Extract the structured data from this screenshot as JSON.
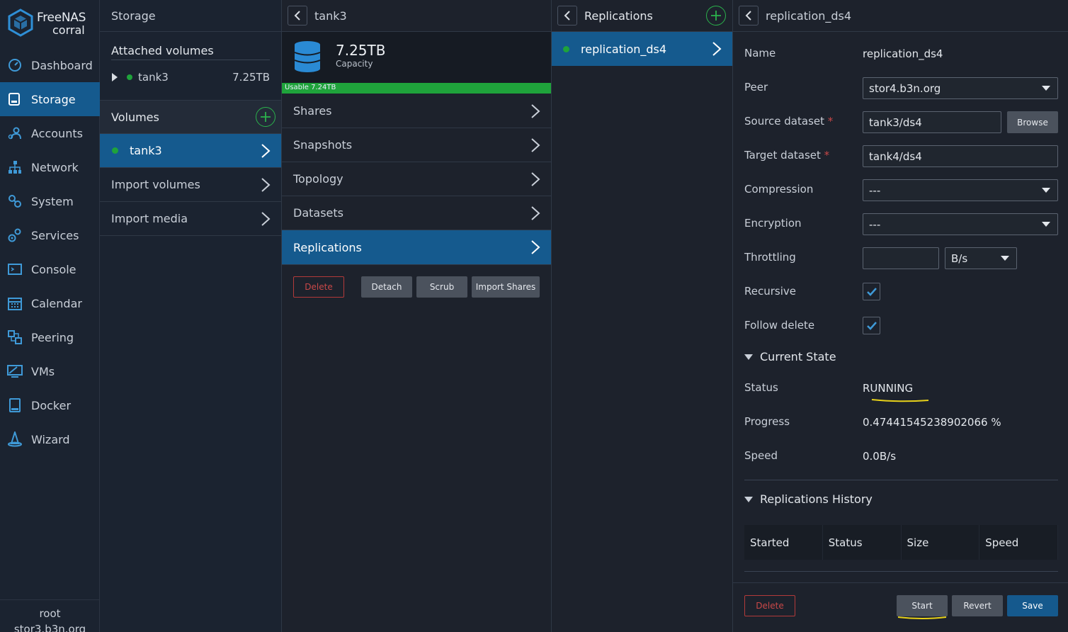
{
  "app": {
    "logo_line1": "FreeNAS",
    "logo_line2": "corral"
  },
  "sidebar": {
    "items": [
      {
        "label": "Dashboard",
        "icon": "dashboard-icon"
      },
      {
        "label": "Storage",
        "icon": "storage-icon",
        "active": true
      },
      {
        "label": "Accounts",
        "icon": "accounts-icon"
      },
      {
        "label": "Network",
        "icon": "network-icon"
      },
      {
        "label": "System",
        "icon": "system-icon"
      },
      {
        "label": "Services",
        "icon": "services-icon"
      },
      {
        "label": "Console",
        "icon": "console-icon"
      },
      {
        "label": "Calendar",
        "icon": "calendar-icon"
      },
      {
        "label": "Peering",
        "icon": "peering-icon"
      },
      {
        "label": "VMs",
        "icon": "vms-icon"
      },
      {
        "label": "Docker",
        "icon": "docker-icon"
      },
      {
        "label": "Wizard",
        "icon": "wizard-icon"
      }
    ],
    "user": "root",
    "host": "stor3.b3n.org"
  },
  "storage": {
    "title": "Storage",
    "attached_title": "Attached volumes",
    "attached": {
      "name": "tank3",
      "size": "7.25TB"
    },
    "volumes_title": "Volumes",
    "volumes": [
      {
        "name": "tank3"
      }
    ],
    "import_volumes": "Import volumes",
    "import_media": "Import media"
  },
  "volume": {
    "title": "tank3",
    "capacity_value": "7.25TB",
    "capacity_label": "Capacity",
    "usable_label": "Usable 7.24TB",
    "usable_fraction": 0.999,
    "menu": [
      "Shares",
      "Snapshots",
      "Topology",
      "Datasets",
      "Replications"
    ],
    "buttons": {
      "delete": "Delete",
      "detach": "Detach",
      "scrub": "Scrub",
      "import_shares": "Import Shares"
    }
  },
  "replications": {
    "title": "Replications",
    "items": [
      {
        "name": "replication_ds4"
      }
    ]
  },
  "detail": {
    "title": "replication_ds4",
    "fields": {
      "name_label": "Name",
      "name_value": "replication_ds4",
      "peer_label": "Peer",
      "peer_value": "stor4.b3n.org",
      "source_label": "Source dataset",
      "source_value": "tank3/ds4",
      "browse": "Browse",
      "target_label": "Target dataset",
      "target_value": "tank4/ds4",
      "compression_label": "Compression",
      "compression_value": "---",
      "encryption_label": "Encryption",
      "encryption_value": "---",
      "throttling_label": "Throttling",
      "throttling_value": "",
      "throttling_unit": "B/s",
      "recursive_label": "Recursive",
      "recursive_checked": true,
      "follow_delete_label": "Follow delete",
      "follow_delete_checked": true
    },
    "current_state": {
      "title": "Current State",
      "status_label": "Status",
      "status_value": "RUNNING",
      "progress_label": "Progress",
      "progress_value": "0.47441545238902066 %",
      "speed_label": "Speed",
      "speed_value": "0.0B/s"
    },
    "history": {
      "title": "Replications History",
      "columns": [
        "Started",
        "Status",
        "Size",
        "Speed"
      ]
    },
    "buttons": {
      "delete": "Delete",
      "start": "Start",
      "revert": "Revert",
      "save": "Save"
    },
    "annotation_color": "#e8d21a"
  }
}
